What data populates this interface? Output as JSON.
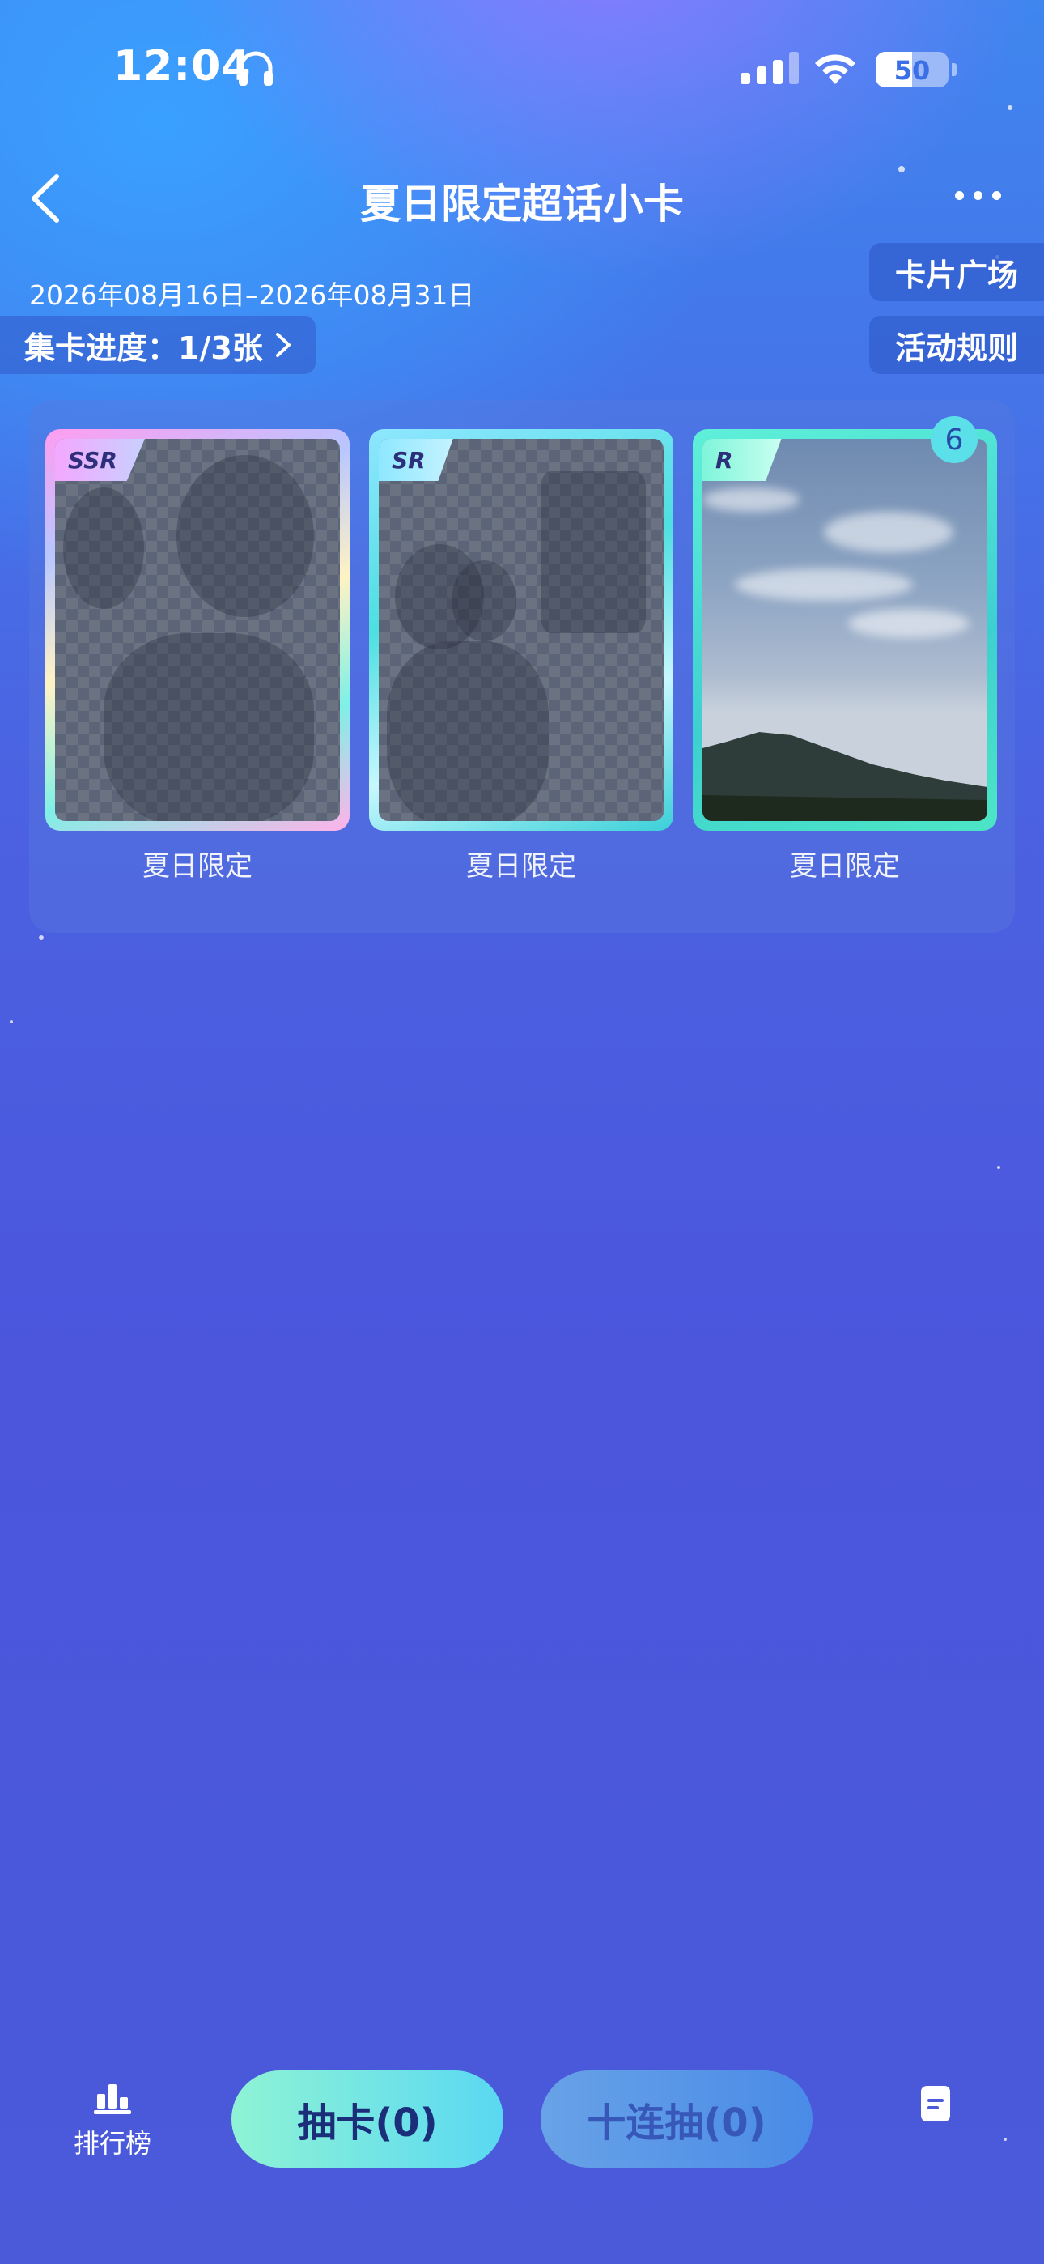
{
  "status_bar": {
    "time": "12:04",
    "battery": "50"
  },
  "nav": {
    "title": "夏日限定超话小卡"
  },
  "event": {
    "date_range": "2026年08月16日–2026年08月31日",
    "progress_label": "集卡进度：1/3张"
  },
  "side_buttons": {
    "card_plaza": "卡片广场",
    "rules": "活动规则"
  },
  "cards": [
    {
      "rarity": "SSR",
      "label": "夏日限定",
      "collected": false
    },
    {
      "rarity": "SR",
      "label": "夏日限定",
      "collected": false
    },
    {
      "rarity": "R",
      "label": "夏日限定",
      "collected": true,
      "count": "6"
    }
  ],
  "bottom_bar": {
    "ranking_label": "排行榜",
    "draw_label": "抽卡(0)",
    "ten_draw_label": "十连抽(0)"
  },
  "colors": {
    "accent_draw": "#5ad8f2",
    "badge": "#5be0ea"
  },
  "icons": [
    "headphones-icon",
    "signal-icon",
    "wifi-icon",
    "battery-icon",
    "back-icon",
    "more-icon",
    "chevron-right-icon",
    "ranking-icon",
    "document-icon"
  ]
}
